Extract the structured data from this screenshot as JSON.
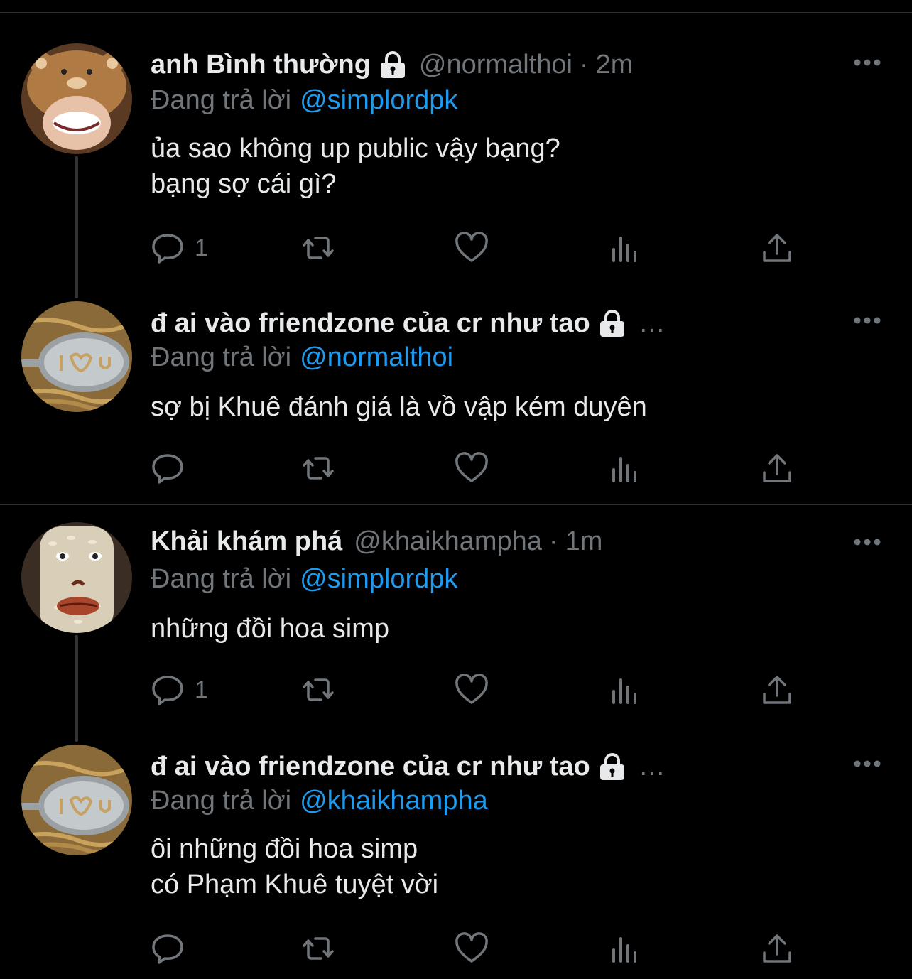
{
  "colors": {
    "background": "#000000",
    "text": "#e7e9ea",
    "muted": "#71767b",
    "mention": "#1d9bf0",
    "divider": "#2f3336"
  },
  "threads": [
    {
      "tweets": [
        {
          "name": "anh Bình thường",
          "locked": true,
          "handle": "@normalthoi",
          "separator": "·",
          "time": "2m",
          "replying_prefix": "Đang trả lời",
          "replying_to": "@simplordpk",
          "lines": [
            "ủa sao không up public vậy bạng?",
            "bạng sợ cái gì?"
          ],
          "reply_count": "1",
          "avatar_icon": "bear-hat-avatar"
        },
        {
          "name": "đ ai vào friendzone của cr như tao",
          "locked": true,
          "truncated": "…",
          "replying_prefix": "Đang trả lời",
          "replying_to": "@normalthoi",
          "lines": [
            "sợ bị Khuê đánh giá là vồ vập kém duyên"
          ],
          "reply_count": "",
          "avatar_icon": "spoon-noodles-avatar"
        }
      ]
    },
    {
      "tweets": [
        {
          "name": "Khải khám phá",
          "locked": false,
          "handle": "@khaikhampha",
          "separator": "·",
          "time": "1m",
          "replying_prefix": "Đang trả lời",
          "replying_to": "@simplordpk",
          "lines": [
            "những đồi hoa simp"
          ],
          "reply_count": "1",
          "avatar_icon": "rice-face-avatar"
        },
        {
          "name": "đ ai vào friendzone của cr như tao",
          "locked": true,
          "truncated": "…",
          "replying_prefix": "Đang trả lời",
          "replying_to": "@khaikhampha",
          "lines": [
            "ôi những đồi hoa simp",
            "có Phạm Khuê tuyệt vời"
          ],
          "reply_count": "",
          "avatar_icon": "spoon-noodles-avatar"
        }
      ]
    }
  ]
}
